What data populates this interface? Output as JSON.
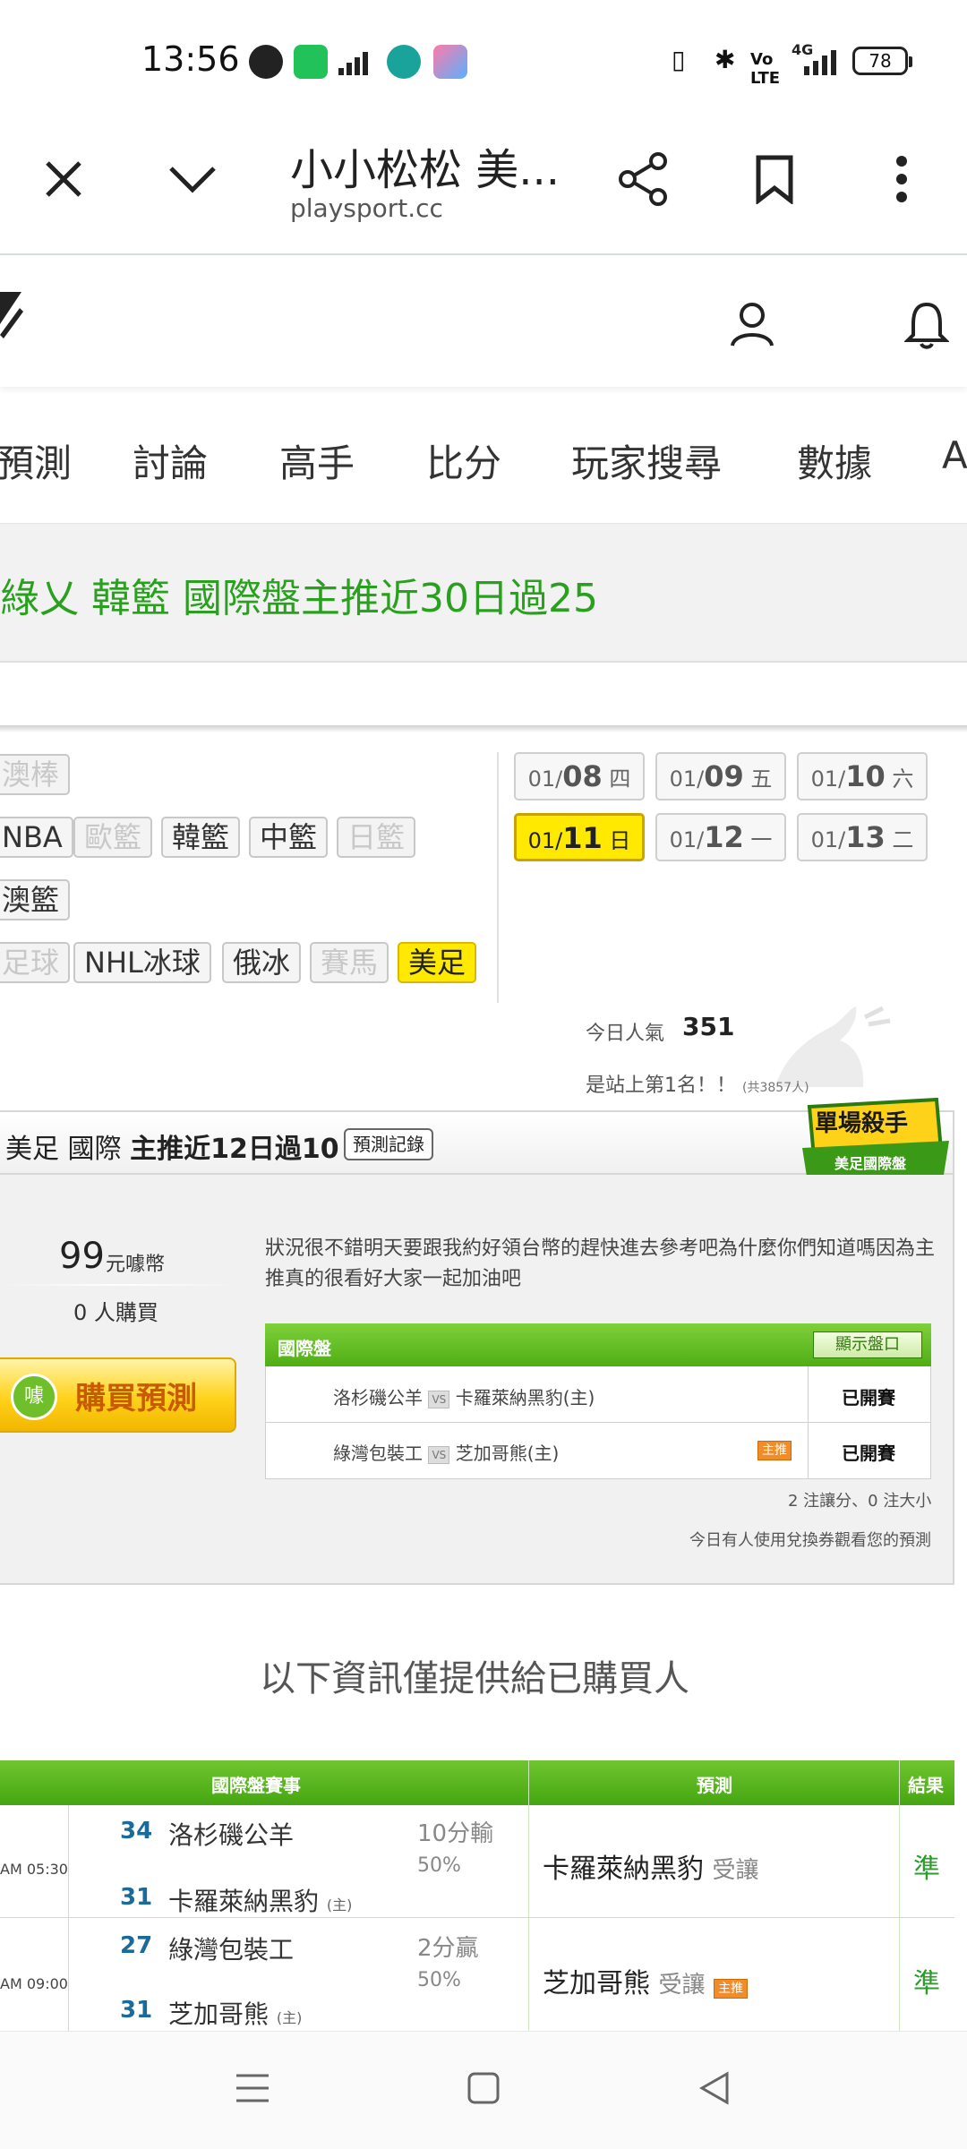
{
  "status_bar": {
    "time": "13:56",
    "battery": "78",
    "network": "4G"
  },
  "browser": {
    "title": "小小松松 美...",
    "url": "playsport.cc"
  },
  "nav": {
    "items": [
      "預測",
      "討論",
      "高手",
      "比分",
      "玩家搜尋",
      "數據",
      "A"
    ]
  },
  "banner": {
    "text": "綠乂 韓籃 國際盤主推近30日過25"
  },
  "sports": {
    "row1": [
      "澳棒"
    ],
    "row2": [
      "NBA",
      "歐籃",
      "韓籃",
      "中籃",
      "日籃"
    ],
    "row3": [
      "澳籃"
    ],
    "row4": [
      "足球",
      "NHL冰球",
      "俄冰",
      "賽馬",
      "美足"
    ]
  },
  "dates": [
    {
      "md": "01/",
      "day": "08",
      "wd": "四"
    },
    {
      "md": "01/",
      "day": "09",
      "wd": "五"
    },
    {
      "md": "01/",
      "day": "10",
      "wd": "六"
    },
    {
      "md": "01/",
      "day": "11",
      "wd": "日"
    },
    {
      "md": "01/",
      "day": "12",
      "wd": "一"
    },
    {
      "md": "01/",
      "day": "13",
      "wd": "二"
    }
  ],
  "popularity": {
    "label": "今日人氣",
    "count": "351",
    "rank": "是站上第1名！！",
    "total": "(共3857人)"
  },
  "card": {
    "league": "美足 國際",
    "headline": "主推近12日過10",
    "record_button": "預測記錄",
    "badge_title": "單場殺手",
    "badge_sub": "美足國際盤",
    "price": "99",
    "price_unit": "元噱幣",
    "buyers_count": "0",
    "buyers_unit": "人購買",
    "buy_button": "購買預測",
    "buy_icon": "噱",
    "description": "狀況很不錯明天要跟我約好領台幣的趕快進去參考吧為什麼你們知道嗎因為主推真的很看好大家一起加油吧",
    "table_title": "國際盤",
    "show_odds_button": "顯示盤口",
    "games": [
      {
        "away": "洛杉磯公羊",
        "vs": "VS",
        "home": "卡羅萊納黑豹(主)",
        "main": "",
        "status": "已開賽"
      },
      {
        "away": "綠灣包裝工",
        "vs": "VS",
        "home": "芝加哥熊(主)",
        "main": "主推",
        "status": "已開賽"
      }
    ],
    "summary": "2 注讓分、0 注大小",
    "coupon_note": "今日有人使用兌換券觀看您的預測"
  },
  "buyers_only": "以下資訊僅提供給已購買人",
  "results": {
    "headers": {
      "event": "國際盤賽事",
      "prediction": "預測",
      "result": "結果"
    },
    "rows": [
      {
        "time": "AM 05:30",
        "score_away": "34",
        "away": "洛杉磯公羊",
        "score_home": "31",
        "home": "卡羅萊納黑豹",
        "home_tag": "(主)",
        "line1": "10分輸",
        "line2": "50%",
        "pick": "卡羅萊納黑豹",
        "pick_type": "受讓",
        "pick_main": "",
        "result": "準"
      },
      {
        "time": "AM 09:00",
        "score_away": "27",
        "away": "綠灣包裝工",
        "score_home": "31",
        "home": "芝加哥熊",
        "home_tag": "(主)",
        "line1": "2分贏",
        "line2": "50%",
        "pick": "芝加哥熊",
        "pick_type": "受讓",
        "pick_main": "主推",
        "result": "準"
      }
    ]
  },
  "colors": {
    "brand_green": "#2aa01f",
    "highlight_yellow": "#ffe900",
    "table_green": "#4fae13"
  }
}
